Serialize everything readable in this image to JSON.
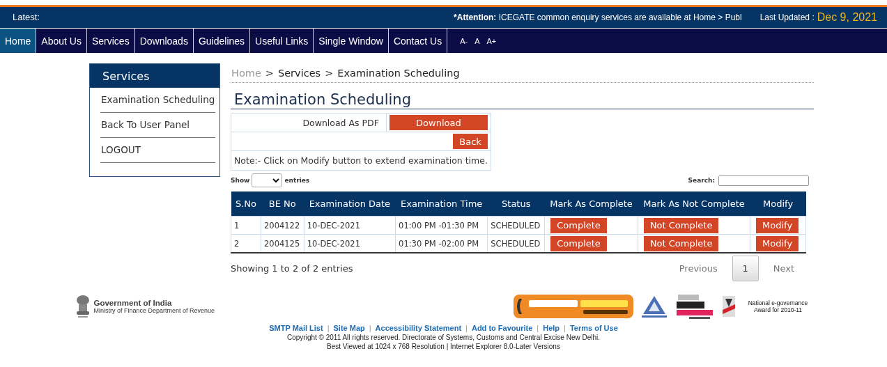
{
  "latest_bar": {
    "label": "Latest:",
    "attention_label": "*Attention:",
    "attention_text": "ICEGATE common enquiry services are available at Home > Publ",
    "updated_label": "Last Updated :",
    "updated_value": "Dec 9, 2021"
  },
  "nav": [
    {
      "label": "Home",
      "selected": true
    },
    {
      "label": "About Us",
      "selected": false
    },
    {
      "label": "Services",
      "selected": false
    },
    {
      "label": "Downloads",
      "selected": false
    },
    {
      "label": "Guidelines",
      "selected": false
    },
    {
      "label": "Useful Links",
      "selected": false
    },
    {
      "label": "Single Window",
      "selected": false
    },
    {
      "label": "Contact Us",
      "selected": false
    }
  ],
  "font_sizes": [
    "A-",
    "A",
    "A+"
  ],
  "sidebar": {
    "title": "Services",
    "items": [
      "Examination Scheduling",
      "Back To User Panel",
      "LOGOUT"
    ]
  },
  "breadcrumb": [
    "Home",
    "Services",
    "Examination Scheduling"
  ],
  "breadcrumb_separator": ">",
  "page_title": "Examination Scheduling",
  "download_label": "Download As PDF",
  "download_button": "Download",
  "back_button": "Back",
  "note": "Note:- Click on Modify button to extend examination time.",
  "show_label": "Show",
  "entries_label": "entries",
  "search_label": "Search:",
  "table": {
    "columns": [
      "S.No",
      "BE No",
      "Examination Date",
      "Examination Time",
      "Status",
      "Mark As Complete",
      "Mark As Not Complete",
      "Modify"
    ],
    "rows": [
      {
        "sno": "1",
        "be_no": "2004122",
        "date": "10-DEC-2021",
        "time": "01:00 PM -01:30 PM",
        "status": "SCHEDULED",
        "complete": "Complete",
        "not_complete": "Not Complete",
        "modify": "Modify"
      },
      {
        "sno": "2",
        "be_no": "2004125",
        "date": "10-DEC-2021",
        "time": "01:30 PM -02:00 PM",
        "status": "SCHEDULED",
        "complete": "Complete",
        "not_complete": "Not Complete",
        "modify": "Modify"
      }
    ]
  },
  "table_info": "Showing 1 to 2 of 2 entries",
  "pagination": [
    {
      "label": "Previous",
      "kind": "link",
      "selected": false
    },
    {
      "label": "1",
      "kind": "page",
      "selected": true
    },
    {
      "label": "Next",
      "kind": "link",
      "selected": false
    }
  ],
  "footer": {
    "gov_title": "Government of India",
    "gov_subtitle": "Ministry of Finance Department of Revenue",
    "award_text": "National e-governance Award for 2010-11",
    "links": [
      "SMTP Mail List",
      "Site Map",
      "Accessibility Statement",
      "Add to Favourite",
      "Help",
      "Terms of Use"
    ],
    "link_separator": "|",
    "copyright": "Copyright © 2011 All rights reserved. Directorate of Systems, Customs and Central Excise New Delhi.",
    "best_viewed": "Best Viewed at 1024 x 768 Resolution | Internet Explorer 8.0-Later Versions"
  }
}
